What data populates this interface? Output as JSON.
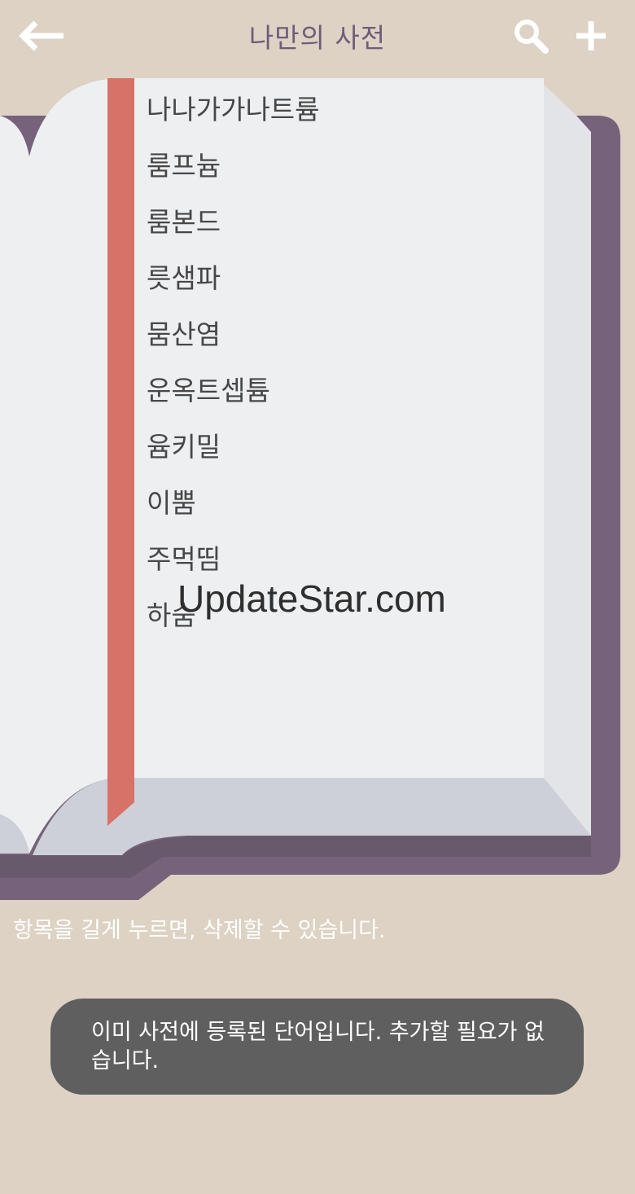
{
  "app_bar": {
    "title": "나만의 사전",
    "back_icon": "arrow-left-icon",
    "search_icon": "search-icon",
    "add_icon": "plus-icon",
    "title_color": "#705c79"
  },
  "words": [
    "나나가가나트륨",
    "룸프늄",
    "룸본드",
    "릇샘파",
    "뭄산염",
    "운옥트셉튬",
    "윰키밀",
    "이뿜",
    "주먹띰",
    "하숨"
  ],
  "watermark": "UpdateStar.com",
  "hint": "항목을 길게 누르면, 삭제할 수 있습니다.",
  "toast": "이미 사전에 등록된 단어입니다. 추가할 필요가 없습니다.",
  "colors": {
    "background": "#ddd2c3",
    "book_cover": "#76627b",
    "page": "#eeeff1",
    "bookmark": "#d77268",
    "toast_bg": "#5f5f5f"
  }
}
